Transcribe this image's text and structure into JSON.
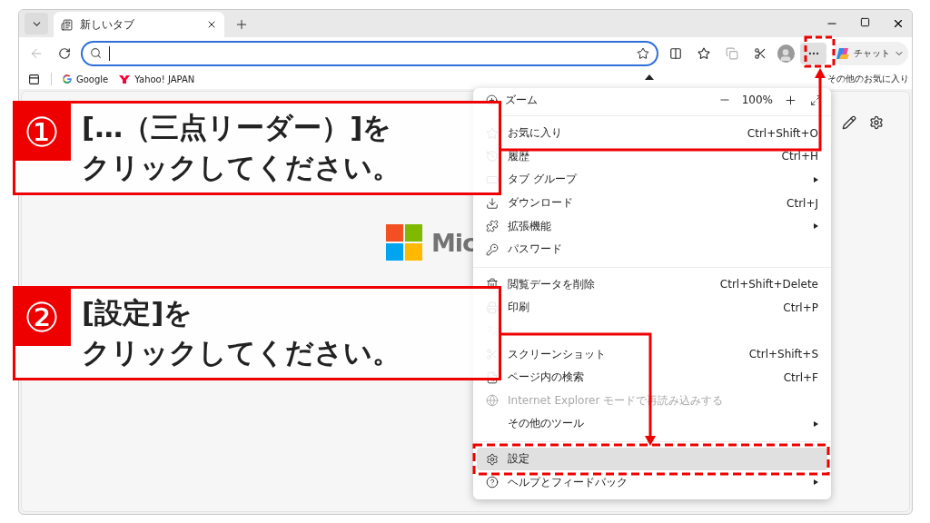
{
  "tabs": [
    {
      "title": "新しいタブ",
      "selected": true
    }
  ],
  "toolbar": {
    "copilot_label": "チャット",
    "more_selected": true
  },
  "bookmarks": [
    {
      "label": "Google",
      "kind": "google"
    },
    {
      "label": "Yahoo! JAPAN",
      "kind": "yahoo"
    }
  ],
  "other_favorites": "その他のお気に入り",
  "logo_text": "Mic",
  "menu": {
    "zoom": {
      "label": "ズーム",
      "value": "100%"
    },
    "items": [
      {
        "kind": "separator"
      },
      {
        "kind": "item",
        "label": "お気に入り",
        "shortcut": "Ctrl+Shift+O",
        "submenu": false,
        "disabled": false,
        "selected": false
      },
      {
        "kind": "item",
        "label": "履歴",
        "shortcut": "Ctrl+H",
        "submenu": false,
        "disabled": false,
        "selected": false
      },
      {
        "kind": "item",
        "label": "タブ グループ",
        "submenu": true,
        "disabled": false,
        "selected": false
      },
      {
        "kind": "item",
        "label": "ダウンロード",
        "shortcut": "Ctrl+J",
        "submenu": false,
        "disabled": false,
        "selected": false
      },
      {
        "kind": "item",
        "label": "拡張機能",
        "submenu": true,
        "disabled": false,
        "selected": false
      },
      {
        "kind": "item",
        "label": "パスワード",
        "submenu": false,
        "disabled": false,
        "selected": false
      },
      {
        "kind": "separator"
      },
      {
        "kind": "item",
        "label": "閲覧データを削除",
        "shortcut": "Ctrl+Shift+Delete",
        "submenu": false,
        "disabled": false,
        "selected": false
      },
      {
        "kind": "item",
        "label": "印刷",
        "shortcut": "Ctrl+P",
        "submenu": false,
        "disabled": false,
        "selected": false
      },
      {
        "kind": "item",
        "submenu": false,
        "disabled": true,
        "selected": false
      },
      {
        "kind": "item",
        "label": "スクリーンショット",
        "shortcut": "Ctrl+Shift+S",
        "submenu": false,
        "disabled": false,
        "selected": false
      },
      {
        "kind": "item",
        "label": "ページ内の検索",
        "shortcut": "Ctrl+F",
        "submenu": false,
        "disabled": false,
        "selected": false
      },
      {
        "kind": "item",
        "label": "Internet Explorer モードで再読み込みする",
        "submenu": false,
        "disabled": true,
        "selected": false
      },
      {
        "kind": "item",
        "label": "その他のツール",
        "submenu": true,
        "disabled": false,
        "selected": false
      },
      {
        "kind": "separator"
      },
      {
        "kind": "item",
        "label": "設定",
        "submenu": false,
        "disabled": false,
        "selected": true
      },
      {
        "kind": "item",
        "label": "ヘルプとフィードバック",
        "submenu": true,
        "disabled": false,
        "selected": false
      }
    ]
  },
  "callouts": [
    {
      "number": "①",
      "lines": [
        "[…（三点リーダー）]を",
        "クリックしてください。"
      ]
    },
    {
      "number": "②",
      "lines": [
        "[設定]を",
        "クリックしてください。"
      ]
    }
  ]
}
